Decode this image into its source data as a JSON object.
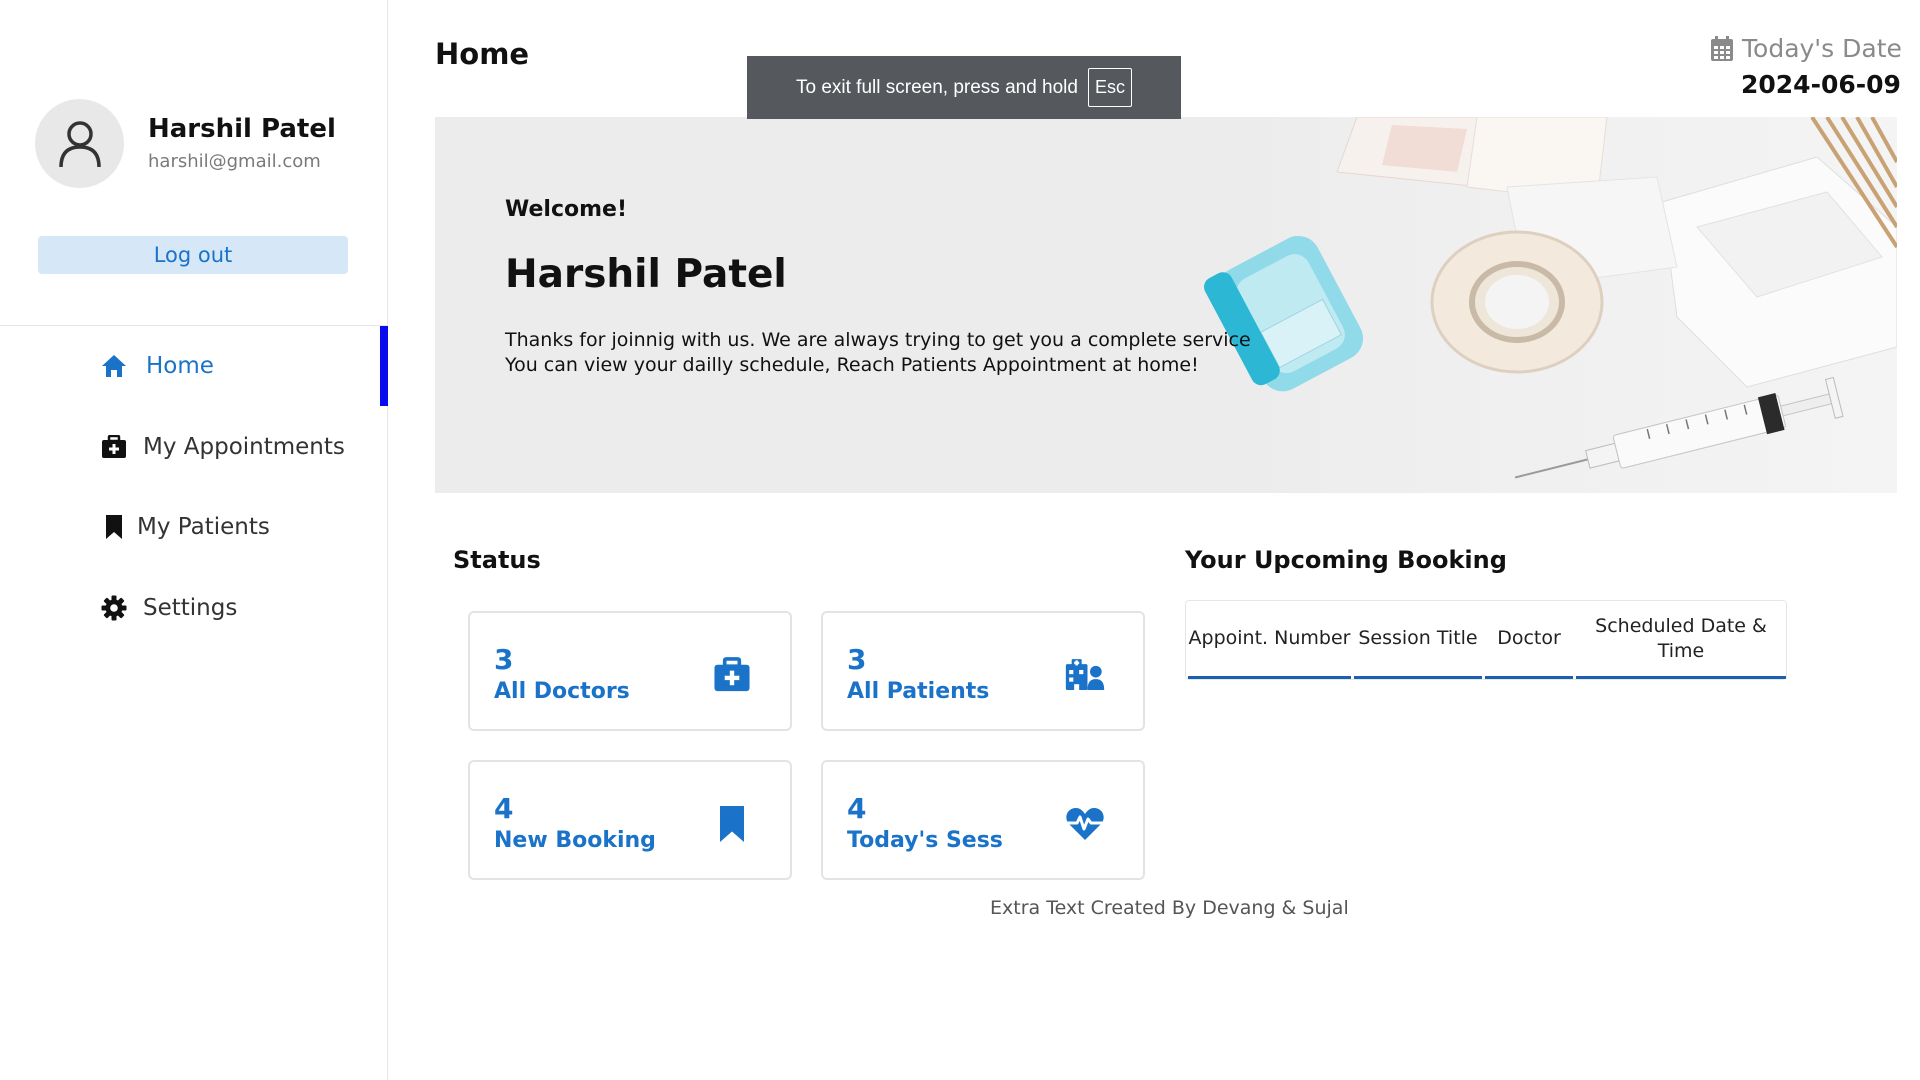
{
  "sidebar": {
    "profile": {
      "name": "Harshil Patel",
      "email": "harshil@gmail.com"
    },
    "logout_label": "Log out",
    "items": [
      {
        "label": "Home",
        "icon": "home-icon",
        "active": true
      },
      {
        "label": "My Appointments",
        "icon": "medical-bag-icon",
        "active": false
      },
      {
        "label": "My Patients",
        "icon": "bookmark-icon",
        "active": false
      },
      {
        "label": "Settings",
        "icon": "gear-icon",
        "active": false
      }
    ]
  },
  "header": {
    "title": "Home",
    "date_label": "Today's Date",
    "date_value": "2024-06-09"
  },
  "fullscreen_toast": {
    "text": "To exit full screen, press and hold",
    "key": "Esc"
  },
  "hero": {
    "welcome": "Welcome!",
    "name": "Harshil Patel",
    "line1": "Thanks for joinnig with us. We are always trying to get you a complete service",
    "line2": "You can view your dailly schedule, Reach Patients Appointment at home!"
  },
  "status": {
    "title": "Status",
    "cards": [
      {
        "value": "3",
        "label": "All Doctors",
        "icon": "medical-bag-icon"
      },
      {
        "value": "3",
        "label": "All Patients",
        "icon": "hospital-user-icon"
      },
      {
        "value": "4",
        "label": "New Booking",
        "icon": "bookmark-icon"
      },
      {
        "value": "4",
        "label": "Today's Sess",
        "icon": "heartbeat-icon"
      }
    ]
  },
  "booking": {
    "title": "Your Upcoming Booking",
    "columns": [
      "Appoint. Number",
      "Session Title",
      "Doctor",
      "Scheduled Date & Time"
    ]
  },
  "footer_note": "Extra Text Created By Devang & Sujal",
  "colors": {
    "accent": "#1a73c8",
    "active_bar": "#0a0af0",
    "logout_bg": "#d6e8f7",
    "table_rule": "#1a5fb0"
  }
}
